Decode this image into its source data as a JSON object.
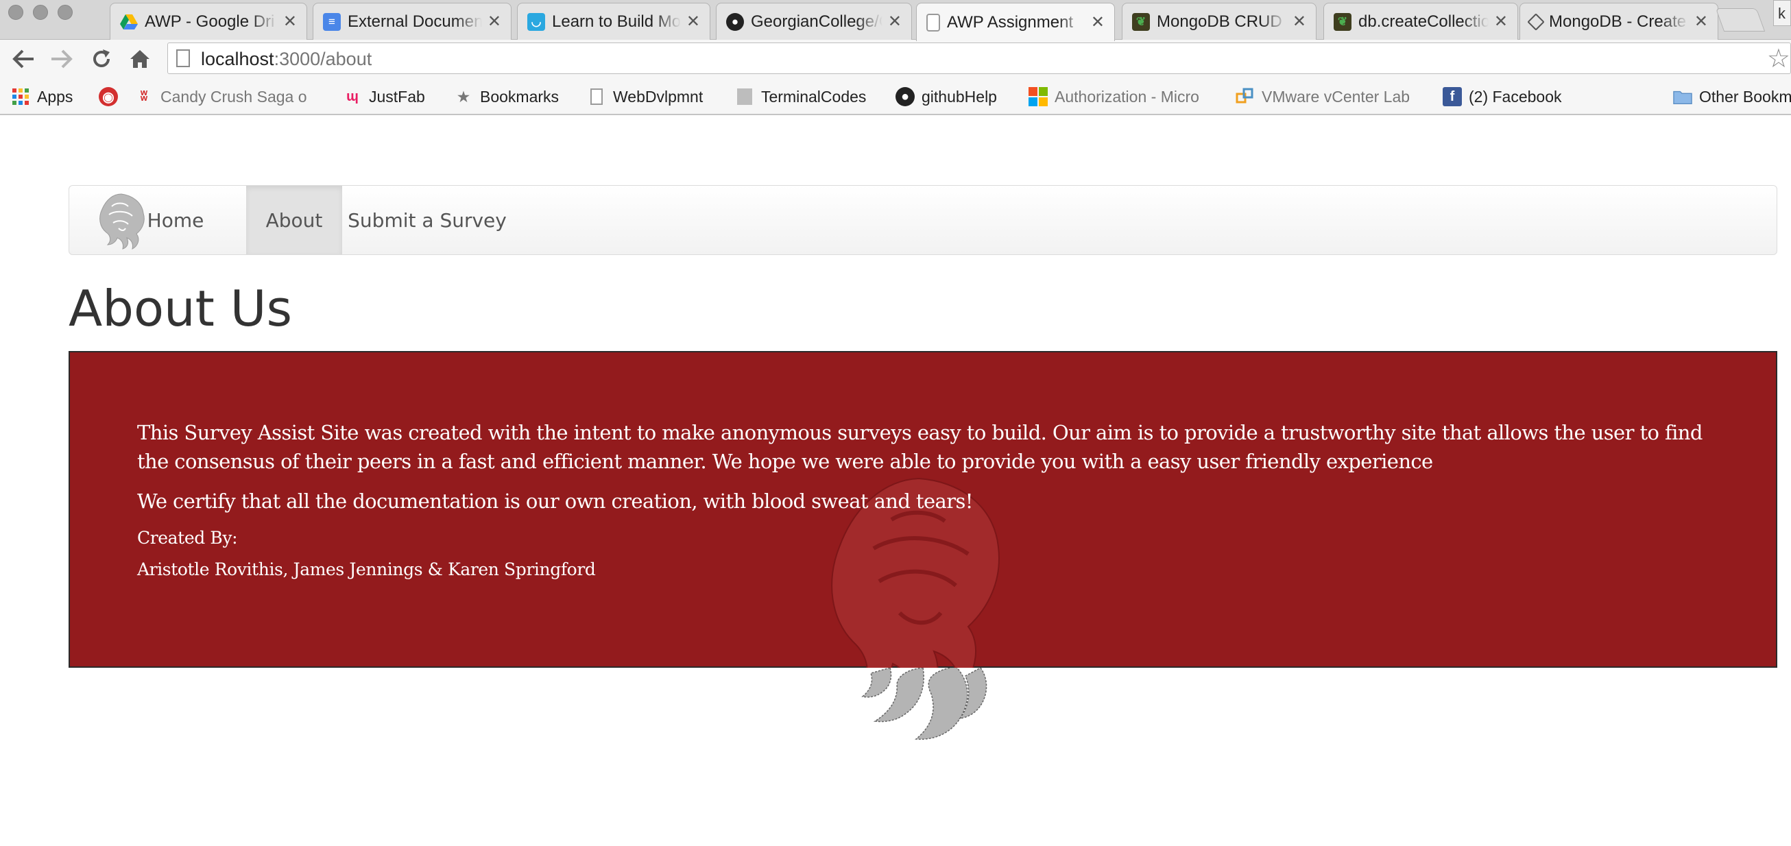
{
  "browser": {
    "tabs": [
      {
        "title": "AWP - Google Dri",
        "favicon": "google-drive-icon",
        "color": "#4285f4"
      },
      {
        "title": "External Documen",
        "favicon": "google-docs-icon",
        "color": "#4a86e8"
      },
      {
        "title": "Learn to Build Mo",
        "favicon": "smile-icon",
        "color": "#2aa8e0"
      },
      {
        "title": "GeorgianCollege/C",
        "favicon": "github-icon",
        "color": "#222222"
      },
      {
        "title": "AWP Assignment",
        "favicon": "page-icon",
        "color": "#ffffff"
      },
      {
        "title": "MongoDB CRUD In",
        "favicon": "mongodb-leaf-icon",
        "color": "#3f3e1f"
      },
      {
        "title": "db.createCollectio",
        "favicon": "mongodb-leaf-icon",
        "color": "#3f3e1f"
      },
      {
        "title": "MongoDB - Create",
        "favicon": "diamond-icon",
        "color": "#ffffff"
      }
    ],
    "corner_label": "k",
    "url_host": "localhost",
    "url_path": ":3000/about",
    "bookmarks": [
      {
        "label": "Apps",
        "icon": "apps-grid-icon"
      },
      {
        "label": "",
        "icon": "lastpass-icon"
      },
      {
        "label": "Candy Crush Saga o",
        "icon": "candy-crush-icon"
      },
      {
        "label": "JustFab",
        "icon": "justfab-icon"
      },
      {
        "label": "Bookmarks",
        "icon": "star-icon"
      },
      {
        "label": "WebDvlpmnt",
        "icon": "page-icon"
      },
      {
        "label": "TerminalCodes",
        "icon": "grey-square-icon"
      },
      {
        "label": "githubHelp",
        "icon": "github-icon"
      },
      {
        "label": "Authorization - Micro",
        "icon": "microsoft-icon"
      },
      {
        "label": "VMware vCenter Lab",
        "icon": "vmware-icon"
      },
      {
        "label": "(2) Facebook",
        "icon": "facebook-icon"
      },
      {
        "label": "Other Bookm",
        "icon": "folder-icon"
      }
    ]
  },
  "nav": {
    "items": [
      {
        "label": "Home",
        "active": false
      },
      {
        "label": "About",
        "active": true
      },
      {
        "label": "Submit a Survey",
        "active": false
      }
    ]
  },
  "page": {
    "title": "About Us",
    "intro": "This Survey Assist Site was created with the intent to make anonymous surveys easy to build. Our aim is to provide a trustworthy site that allows the user to find the consensus of their peers in a fast and efficient manner. We hope we were able to provide you with a easy user friendly experience",
    "certify": "We certify that all the documentation is our own creation, with blood sweat and tears!",
    "created_by_label": "Created By:",
    "authors": "Aristotle Rovithis, James Jennings & Karen Springford"
  },
  "colors": {
    "panel": "#931b1d",
    "panel_text": "#ffffff",
    "nav_active": "#e2e2e2"
  }
}
